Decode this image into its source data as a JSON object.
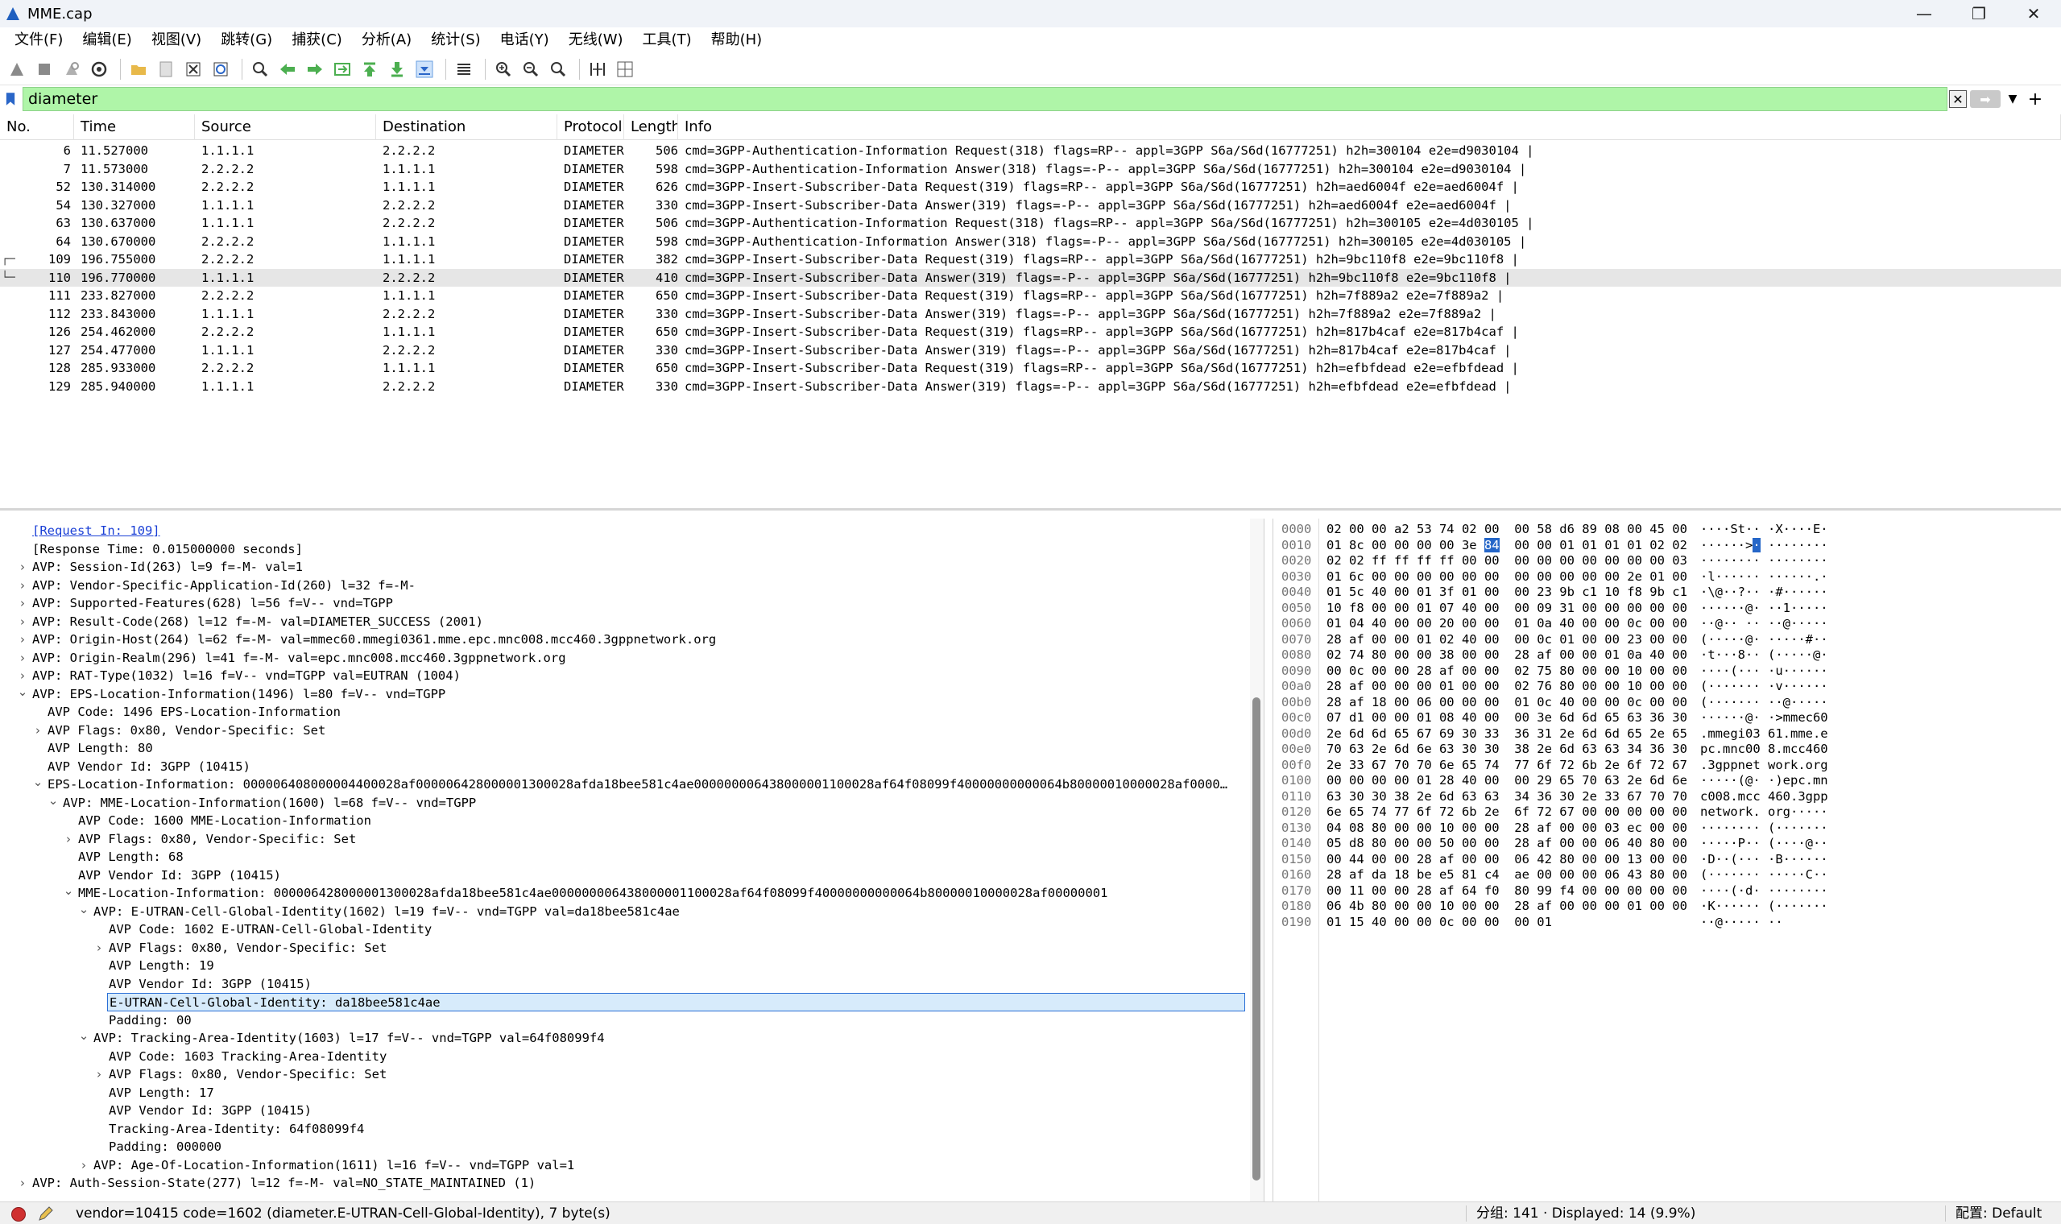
{
  "window": {
    "title": "MME.cap"
  },
  "menu": [
    "文件(F)",
    "编辑(E)",
    "视图(V)",
    "跳转(G)",
    "捕获(C)",
    "分析(A)",
    "统计(S)",
    "电话(Y)",
    "无线(W)",
    "工具(T)",
    "帮助(H)"
  ],
  "toolbar": {
    "icons": [
      "shark-fin-start-icon",
      "stop-icon",
      "restart-icon",
      "options-gear-icon",
      "open-folder-icon",
      "save-file-icon",
      "close-file-icon",
      "reload-icon",
      "search-icon",
      "back-arrow-icon",
      "forward-arrow-icon",
      "goto-packet-icon",
      "first-packet-icon",
      "last-packet-icon",
      "autoscroll-icon",
      "colorize-icon",
      "zoom-in-icon",
      "zoom-out-icon",
      "zoom-normal-icon",
      "resize-columns-icon",
      "layout-icon"
    ]
  },
  "filter": {
    "value": "diameter"
  },
  "packet_list": {
    "headers": [
      "No.",
      "Time",
      "Source",
      "Destination",
      "Protocol",
      "Length",
      "Info"
    ],
    "rows": [
      {
        "no": "6",
        "time": "11.527000",
        "src": "1.1.1.1",
        "dst": "2.2.2.2",
        "proto": "DIAMETER",
        "len": "506",
        "info": "cmd=3GPP-Authentication-Information Request(318) flags=RP-- appl=3GPP S6a/S6d(16777251) h2h=300104 e2e=d9030104 |"
      },
      {
        "no": "7",
        "time": "11.573000",
        "src": "2.2.2.2",
        "dst": "1.1.1.1",
        "proto": "DIAMETER",
        "len": "598",
        "info": "cmd=3GPP-Authentication-Information Answer(318) flags=-P-- appl=3GPP S6a/S6d(16777251) h2h=300104 e2e=d9030104 |"
      },
      {
        "no": "52",
        "time": "130.314000",
        "src": "2.2.2.2",
        "dst": "1.1.1.1",
        "proto": "DIAMETER",
        "len": "626",
        "info": "cmd=3GPP-Insert-Subscriber-Data Request(319) flags=RP-- appl=3GPP S6a/S6d(16777251) h2h=aed6004f e2e=aed6004f |"
      },
      {
        "no": "54",
        "time": "130.327000",
        "src": "1.1.1.1",
        "dst": "2.2.2.2",
        "proto": "DIAMETER",
        "len": "330",
        "info": "cmd=3GPP-Insert-Subscriber-Data Answer(319) flags=-P-- appl=3GPP S6a/S6d(16777251) h2h=aed6004f e2e=aed6004f |"
      },
      {
        "no": "63",
        "time": "130.637000",
        "src": "1.1.1.1",
        "dst": "2.2.2.2",
        "proto": "DIAMETER",
        "len": "506",
        "info": "cmd=3GPP-Authentication-Information Request(318) flags=RP-- appl=3GPP S6a/S6d(16777251) h2h=300105 e2e=4d030105 |"
      },
      {
        "no": "64",
        "time": "130.670000",
        "src": "2.2.2.2",
        "dst": "1.1.1.1",
        "proto": "DIAMETER",
        "len": "598",
        "info": "cmd=3GPP-Authentication-Information Answer(318) flags=-P-- appl=3GPP S6a/S6d(16777251) h2h=300105 e2e=4d030105 |"
      },
      {
        "no": "109",
        "time": "196.755000",
        "src": "2.2.2.2",
        "dst": "1.1.1.1",
        "proto": "DIAMETER",
        "len": "382",
        "info": "cmd=3GPP-Insert-Subscriber-Data Request(319) flags=RP-- appl=3GPP S6a/S6d(16777251) h2h=9bc110f8 e2e=9bc110f8 |",
        "mark": "┌─"
      },
      {
        "no": "110",
        "time": "196.770000",
        "src": "1.1.1.1",
        "dst": "2.2.2.2",
        "proto": "DIAMETER",
        "len": "410",
        "info": "cmd=3GPP-Insert-Subscriber-Data Answer(319) flags=-P-- appl=3GPP S6a/S6d(16777251) h2h=9bc110f8 e2e=9bc110f8 |",
        "mark": "└─",
        "selected": true
      },
      {
        "no": "111",
        "time": "233.827000",
        "src": "2.2.2.2",
        "dst": "1.1.1.1",
        "proto": "DIAMETER",
        "len": "650",
        "info": "cmd=3GPP-Insert-Subscriber-Data Request(319) flags=RP-- appl=3GPP S6a/S6d(16777251) h2h=7f889a2 e2e=7f889a2 |"
      },
      {
        "no": "112",
        "time": "233.843000",
        "src": "1.1.1.1",
        "dst": "2.2.2.2",
        "proto": "DIAMETER",
        "len": "330",
        "info": "cmd=3GPP-Insert-Subscriber-Data Answer(319) flags=-P-- appl=3GPP S6a/S6d(16777251) h2h=7f889a2 e2e=7f889a2 |"
      },
      {
        "no": "126",
        "time": "254.462000",
        "src": "2.2.2.2",
        "dst": "1.1.1.1",
        "proto": "DIAMETER",
        "len": "650",
        "info": "cmd=3GPP-Insert-Subscriber-Data Request(319) flags=RP-- appl=3GPP S6a/S6d(16777251) h2h=817b4caf e2e=817b4caf |"
      },
      {
        "no": "127",
        "time": "254.477000",
        "src": "1.1.1.1",
        "dst": "2.2.2.2",
        "proto": "DIAMETER",
        "len": "330",
        "info": "cmd=3GPP-Insert-Subscriber-Data Answer(319) flags=-P-- appl=3GPP S6a/S6d(16777251) h2h=817b4caf e2e=817b4caf |"
      },
      {
        "no": "128",
        "time": "285.933000",
        "src": "2.2.2.2",
        "dst": "1.1.1.1",
        "proto": "DIAMETER",
        "len": "650",
        "info": "cmd=3GPP-Insert-Subscriber-Data Request(319) flags=RP-- appl=3GPP S6a/S6d(16777251) h2h=efbfdead e2e=efbfdead |"
      },
      {
        "no": "129",
        "time": "285.940000",
        "src": "1.1.1.1",
        "dst": "2.2.2.2",
        "proto": "DIAMETER",
        "len": "330",
        "info": "cmd=3GPP-Insert-Subscriber-Data Answer(319) flags=-P-- appl=3GPP S6a/S6d(16777251) h2h=efbfdead e2e=efbfdead |"
      }
    ]
  },
  "details": [
    {
      "level": 1,
      "text": "[Request In: 109]",
      "link": true
    },
    {
      "level": 1,
      "text": "[Response Time: 0.015000000 seconds]"
    },
    {
      "level": 1,
      "text": "AVP: Session-Id(263) l=9 f=-M- val=1",
      "arrow": ">"
    },
    {
      "level": 1,
      "text": "AVP: Vendor-Specific-Application-Id(260) l=32 f=-M-",
      "arrow": ">"
    },
    {
      "level": 1,
      "text": "AVP: Supported-Features(628) l=56 f=V-- vnd=TGPP",
      "arrow": ">"
    },
    {
      "level": 1,
      "text": "AVP: Result-Code(268) l=12 f=-M- val=DIAMETER_SUCCESS (2001)",
      "arrow": ">"
    },
    {
      "level": 1,
      "text": "AVP: Origin-Host(264) l=62 f=-M- val=mmec60.mmegi0361.mme.epc.mnc008.mcc460.3gppnetwork.org",
      "arrow": ">"
    },
    {
      "level": 1,
      "text": "AVP: Origin-Realm(296) l=41 f=-M- val=epc.mnc008.mcc460.3gppnetwork.org",
      "arrow": ">"
    },
    {
      "level": 1,
      "text": "AVP: RAT-Type(1032) l=16 f=V-- vnd=TGPP val=EUTRAN (1004)",
      "arrow": ">"
    },
    {
      "level": 1,
      "text": "AVP: EPS-Location-Information(1496) l=80 f=V-- vnd=TGPP",
      "arrow": "v"
    },
    {
      "level": 2,
      "text": "AVP Code: 1496 EPS-Location-Information"
    },
    {
      "level": 2,
      "text": "AVP Flags: 0x80, Vendor-Specific: Set",
      "arrow": ">"
    },
    {
      "level": 2,
      "text": "AVP Length: 80"
    },
    {
      "level": 2,
      "text": "AVP Vendor Id: 3GPP (10415)"
    },
    {
      "level": 2,
      "text": "EPS-Location-Information: 000006408000004400028af000006428000001300028afda18bee581c4ae000000006438000001100028af64f08099f40000000000064b80000010000028af0000…",
      "arrow": "v"
    },
    {
      "level": 3,
      "text": "AVP: MME-Location-Information(1600) l=68 f=V-- vnd=TGPP",
      "arrow": "v"
    },
    {
      "level": 4,
      "text": "AVP Code: 1600 MME-Location-Information"
    },
    {
      "level": 4,
      "text": "AVP Flags: 0x80, Vendor-Specific: Set",
      "arrow": ">"
    },
    {
      "level": 4,
      "text": "AVP Length: 68"
    },
    {
      "level": 4,
      "text": "AVP Vendor Id: 3GPP (10415)"
    },
    {
      "level": 4,
      "text": "MME-Location-Information: 000006428000001300028afda18bee581c4ae000000006438000001100028af64f08099f40000000000064b80000010000028af00000001",
      "arrow": "v"
    },
    {
      "level": 5,
      "text": "AVP: E-UTRAN-Cell-Global-Identity(1602) l=19 f=V-- vnd=TGPP val=da18bee581c4ae",
      "arrow": "v"
    },
    {
      "level": 6,
      "text": "AVP Code: 1602 E-UTRAN-Cell-Global-Identity"
    },
    {
      "level": 6,
      "text": "AVP Flags: 0x80, Vendor-Specific: Set",
      "arrow": ">"
    },
    {
      "level": 6,
      "text": "AVP Length: 19"
    },
    {
      "level": 6,
      "text": "AVP Vendor Id: 3GPP (10415)"
    },
    {
      "level": 6,
      "text": "E-UTRAN-Cell-Global-Identity: da18bee581c4ae",
      "highlight": true
    },
    {
      "level": 6,
      "text": "Padding: 00"
    },
    {
      "level": 5,
      "text": "AVP: Tracking-Area-Identity(1603) l=17 f=V-- vnd=TGPP val=64f08099f4",
      "arrow": "v"
    },
    {
      "level": 6,
      "text": "AVP Code: 1603 Tracking-Area-Identity"
    },
    {
      "level": 6,
      "text": "AVP Flags: 0x80, Vendor-Specific: Set",
      "arrow": ">"
    },
    {
      "level": 6,
      "text": "AVP Length: 17"
    },
    {
      "level": 6,
      "text": "AVP Vendor Id: 3GPP (10415)"
    },
    {
      "level": 6,
      "text": "Tracking-Area-Identity: 64f08099f4"
    },
    {
      "level": 6,
      "text": "Padding: 000000"
    },
    {
      "level": 5,
      "text": "AVP: Age-Of-Location-Information(1611) l=16 f=V-- vnd=TGPP val=1",
      "arrow": ">"
    },
    {
      "level": 1,
      "text": "AVP: Auth-Session-State(277) l=12 f=-M- val=NO_STATE_MAINTAINED (1)",
      "arrow": ">"
    }
  ],
  "bytes": [
    {
      "off": "0000",
      "hex": "02 00 00 a2 53 74 02 00  00 58 d6 89 08 00 45 00",
      "asc": "····St·· ·X····E·"
    },
    {
      "off": "0010",
      "hex": "01 8c 00 00 00 00 3e ",
      "sel": "84",
      "hex2": "  00 00 01 01 01 01 02 02",
      "asc": "······>",
      "asel": "·",
      "asc2": " ········"
    },
    {
      "off": "0020",
      "hex": "02 02 ff ff ff ff 00 00  00 00 00 00 00 00 00 03",
      "asc": "········ ········"
    },
    {
      "off": "0030",
      "hex": "01 6c 00 00 00 00 00 00  00 00 00 00 00 2e 01 00",
      "asc": "·l······ ······.·"
    },
    {
      "off": "0040",
      "hex": "01 5c 40 00 01 3f 01 00  00 23 9b c1 10 f8 9b c1",
      "asc": "·\\@··?·· ·#······"
    },
    {
      "off": "0050",
      "hex": "10 f8 00 00 01 07 40 00  00 09 31 00 00 00 00 00",
      "asc": "······@· ··1·····"
    },
    {
      "off": "0060",
      "hex": "01 04 40 00 00 20 00 00  01 0a 40 00 00 0c 00 00",
      "asc": "··@·· ·· ··@·····"
    },
    {
      "off": "0070",
      "hex": "28 af 00 00 01 02 40 00  00 0c 01 00 00 23 00 00",
      "asc": "(·····@· ·····#··"
    },
    {
      "off": "0080",
      "hex": "02 74 80 00 00 38 00 00  28 af 00 00 01 0a 40 00",
      "asc": "·t···8·· (·····@·"
    },
    {
      "off": "0090",
      "hex": "00 0c 00 00 28 af 00 00  02 75 80 00 00 10 00 00",
      "asc": "····(··· ·u······"
    },
    {
      "off": "00a0",
      "hex": "28 af 00 00 00 01 00 00  02 76 80 00 00 10 00 00",
      "asc": "(······· ·v······"
    },
    {
      "off": "00b0",
      "hex": "28 af 18 00 06 00 00 00  01 0c 40 00 00 0c 00 00",
      "asc": "(······· ··@·····"
    },
    {
      "off": "00c0",
      "hex": "07 d1 00 00 01 08 40 00  00 3e 6d 6d 65 63 36 30",
      "asc": "······@· ·>mmec60"
    },
    {
      "off": "00d0",
      "hex": "2e 6d 6d 65 67 69 30 33  36 31 2e 6d 6d 65 2e 65",
      "asc": ".mmegi03 61.mme.e"
    },
    {
      "off": "00e0",
      "hex": "70 63 2e 6d 6e 63 30 30  38 2e 6d 63 63 34 36 30",
      "asc": "pc.mnc00 8.mcc460"
    },
    {
      "off": "00f0",
      "hex": "2e 33 67 70 70 6e 65 74  77 6f 72 6b 2e 6f 72 67",
      "asc": ".3gppnet work.org"
    },
    {
      "off": "0100",
      "hex": "00 00 00 00 01 28 40 00  00 29 65 70 63 2e 6d 6e",
      "asc": "·····(@· ·)epc.mn"
    },
    {
      "off": "0110",
      "hex": "63 30 30 38 2e 6d 63 63  34 36 30 2e 33 67 70 70",
      "asc": "c008.mcc 460.3gpp"
    },
    {
      "off": "0120",
      "hex": "6e 65 74 77 6f 72 6b 2e  6f 72 67 00 00 00 00 00",
      "asc": "network. org·····"
    },
    {
      "off": "0130",
      "hex": "04 08 80 00 00 10 00 00  28 af 00 00 03 ec 00 00",
      "asc": "········ (·······"
    },
    {
      "off": "0140",
      "hex": "05 d8 80 00 00 50 00 00  28 af 00 00 06 40 80 00",
      "asc": "·····P·· (····@··"
    },
    {
      "off": "0150",
      "hex": "00 44 00 00 28 af 00 00  06 42 80 00 00 13 00 00",
      "asc": "·D··(··· ·B······"
    },
    {
      "off": "0160",
      "hex": "28 af da 18 be e5 81 c4  ae 00 00 00 06 43 80 00",
      "asc": "(······· ·····C··"
    },
    {
      "off": "0170",
      "hex": "00 11 00 00 28 af 64 f0  80 99 f4 00 00 00 00 00",
      "asc": "····(·d· ········"
    },
    {
      "off": "0180",
      "hex": "06 4b 80 00 00 10 00 00  28 af 00 00 00 01 00 00",
      "asc": "·K······ (·······"
    },
    {
      "off": "0190",
      "hex": "01 15 40 00 00 0c 00 00  00 01",
      "asc": "··@····· ··"
    }
  ],
  "status": {
    "field": "vendor=10415 code=1602 (diameter.E-UTRAN-Cell-Global-Identity), 7 byte(s)",
    "packets": "分组: 141 · Displayed: 14 (9.9%)",
    "profile": "配置: Default"
  }
}
